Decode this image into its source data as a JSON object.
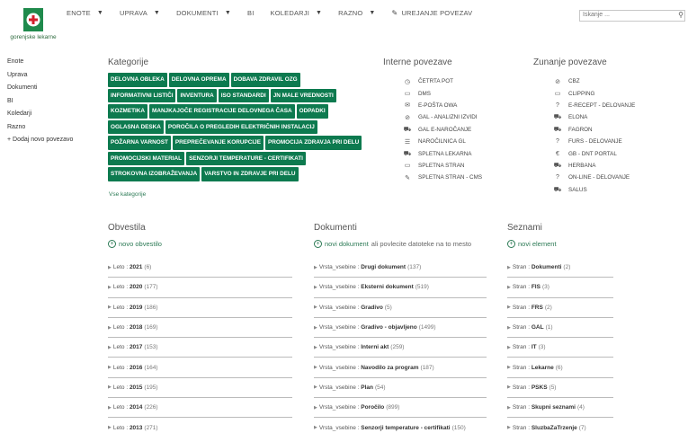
{
  "brand": {
    "name": "gorenjske lekarne"
  },
  "nav": {
    "items": [
      {
        "label": "ENOTE"
      },
      {
        "label": "UPRAVA"
      },
      {
        "label": "DOKUMENTI"
      },
      {
        "label": "BI"
      },
      {
        "label": "KOLEDARJI"
      },
      {
        "label": "RAZNO"
      }
    ],
    "edit_label": "UREJANJE POVEZAV"
  },
  "search": {
    "placeholder": "Iskanje ..."
  },
  "quicklaunch": {
    "items": [
      {
        "label": "Enote"
      },
      {
        "label": "Uprava"
      },
      {
        "label": "Dokumenti"
      },
      {
        "label": "BI"
      },
      {
        "label": "Koledarji"
      },
      {
        "label": "Razno"
      },
      {
        "label": "+ Dodaj novo povezavo"
      }
    ]
  },
  "categories": {
    "title": "Kategorije",
    "rows": [
      [
        "DELOVNA OBLEKA",
        "DELOVNA OPREMA",
        "DOBAVA ZDRAVIL OZG"
      ],
      [
        "INFORMATIVNI LISTIČI",
        "INVENTURA",
        "ISO STANDARDI",
        "JN MALE VREDNOSTI"
      ],
      [
        "KOZMETIKA",
        "MANJKAJOČE REGISTRACIJE DELOVNEGA ČASA",
        "ODPADKI"
      ],
      [
        "OGLASNA DESKA",
        "POROČILA O PREGLEDIH ELEKTRIČNIH INSTALACIJ"
      ],
      [
        "POŽARNA VARNOST",
        "PREPREČEVANJE KORUPCIJE",
        "PROMOCIJA ZDRAVJA PRI DELU"
      ],
      [
        "PROMOCIJSKI MATERIAL",
        "SENZORJI TEMPERATURE - CERTIFIKATI"
      ],
      [
        "STROKOVNA IZOBRAŽEVANJA",
        "VARSTVO IN ZDRAVJE PRI DELU"
      ]
    ],
    "all_label": "Vse kategorije",
    "accent": "#0d7a4f"
  },
  "internal": {
    "title": "Interne povezave",
    "items": [
      {
        "icon": "clock-icon",
        "glyph": "◷",
        "label": "ČETRTA POT"
      },
      {
        "icon": "folder-icon",
        "glyph": "▭",
        "label": "DMS"
      },
      {
        "icon": "mail-icon",
        "glyph": "✉",
        "label": "E-POŠTA OWA"
      },
      {
        "icon": "check-circle-icon",
        "glyph": "⊘",
        "label": "GAL - ANALIZNI IZVIDI"
      },
      {
        "icon": "cart-icon",
        "glyph": "⛟",
        "label": "GAL E-NAROČANJE"
      },
      {
        "icon": "list-icon",
        "glyph": "☰",
        "label": "NAROČILNICA GL"
      },
      {
        "icon": "cart-icon",
        "glyph": "⛟",
        "label": "SPLETNA LEKARNA"
      },
      {
        "icon": "browser-icon",
        "glyph": "▭",
        "label": "SPLETNA STRAN"
      },
      {
        "icon": "pencil-icon",
        "glyph": "✎",
        "label": "SPLETNA STRAN - CMS"
      }
    ]
  },
  "external": {
    "title": "Zunanje povezave",
    "items": [
      {
        "icon": "link-icon",
        "glyph": "⊘",
        "label": "CBZ"
      },
      {
        "icon": "document-icon",
        "glyph": "▭",
        "label": "CLIPPING"
      },
      {
        "icon": "help-icon",
        "glyph": "?",
        "label": "E-RECEPT - DELOVANJE"
      },
      {
        "icon": "cart-icon",
        "glyph": "⛟",
        "label": "ELONA"
      },
      {
        "icon": "cart-icon",
        "glyph": "⛟",
        "label": "FAGRON"
      },
      {
        "icon": "help-icon",
        "glyph": "?",
        "label": "FURS - DELOVANJE"
      },
      {
        "icon": "euro-icon",
        "glyph": "€",
        "label": "GB - DNT PORTAL"
      },
      {
        "icon": "cart-icon",
        "glyph": "⛟",
        "label": "HERBANA"
      },
      {
        "icon": "help-icon",
        "glyph": "?",
        "label": "ON-LINE - DELOVANJE"
      },
      {
        "icon": "cart-icon",
        "glyph": "⛟",
        "label": "SALUS"
      }
    ]
  },
  "news": {
    "title": "Obvestila",
    "add_label": "novo obvestilo",
    "rows": [
      {
        "key": "Leto :",
        "value": "2021",
        "count": "(6)"
      },
      {
        "key": "Leto :",
        "value": "2020",
        "count": "(177)"
      },
      {
        "key": "Leto :",
        "value": "2019",
        "count": "(186)"
      },
      {
        "key": "Leto :",
        "value": "2018",
        "count": "(169)"
      },
      {
        "key": "Leto :",
        "value": "2017",
        "count": "(153)"
      },
      {
        "key": "Leto :",
        "value": "2016",
        "count": "(164)"
      },
      {
        "key": "Leto :",
        "value": "2015",
        "count": "(195)"
      },
      {
        "key": "Leto :",
        "value": "2014",
        "count": "(226)"
      },
      {
        "key": "Leto :",
        "value": "2013",
        "count": "(271)"
      }
    ]
  },
  "documents": {
    "title": "Dokumenti",
    "add_label": "novi dokument",
    "add_hint": "ali povlecite datoteke na to mesto",
    "rows": [
      {
        "key": "Vrsta_vsebine :",
        "value": "Drugi dokument",
        "count": "(137)"
      },
      {
        "key": "Vrsta_vsebine :",
        "value": "Eksterni dokument",
        "count": "(519)"
      },
      {
        "key": "Vrsta_vsebine :",
        "value": "Gradivo",
        "count": "(5)"
      },
      {
        "key": "Vrsta_vsebine :",
        "value": "Gradivo - objavljeno",
        "count": "(1499)"
      },
      {
        "key": "Vrsta_vsebine :",
        "value": "Interni akt",
        "count": "(259)"
      },
      {
        "key": "Vrsta_vsebine :",
        "value": "Navodilo za program",
        "count": "(187)"
      },
      {
        "key": "Vrsta_vsebine :",
        "value": "Plan",
        "count": "(54)"
      },
      {
        "key": "Vrsta_vsebine :",
        "value": "Poročilo",
        "count": "(899)"
      },
      {
        "key": "Vrsta_vsebine :",
        "value": "Senzorji temperature - certifikati",
        "count": "(150)"
      }
    ]
  },
  "lists": {
    "title": "Seznami",
    "add_label": "novi element",
    "rows": [
      {
        "key": "Stran :",
        "value": "Dokumenti",
        "count": "(2)"
      },
      {
        "key": "Stran :",
        "value": "FIS",
        "count": "(3)"
      },
      {
        "key": "Stran :",
        "value": "FRS",
        "count": "(2)"
      },
      {
        "key": "Stran :",
        "value": "GAL",
        "count": "(1)"
      },
      {
        "key": "Stran :",
        "value": "IT",
        "count": "(3)"
      },
      {
        "key": "Stran :",
        "value": "Lekarne",
        "count": "(6)"
      },
      {
        "key": "Stran :",
        "value": "PSKS",
        "count": "(5)"
      },
      {
        "key": "Stran :",
        "value": "Skupni seznami",
        "count": "(4)"
      },
      {
        "key": "Stran :",
        "value": "SluzbaZaTrzenje",
        "count": "(7)"
      }
    ]
  }
}
